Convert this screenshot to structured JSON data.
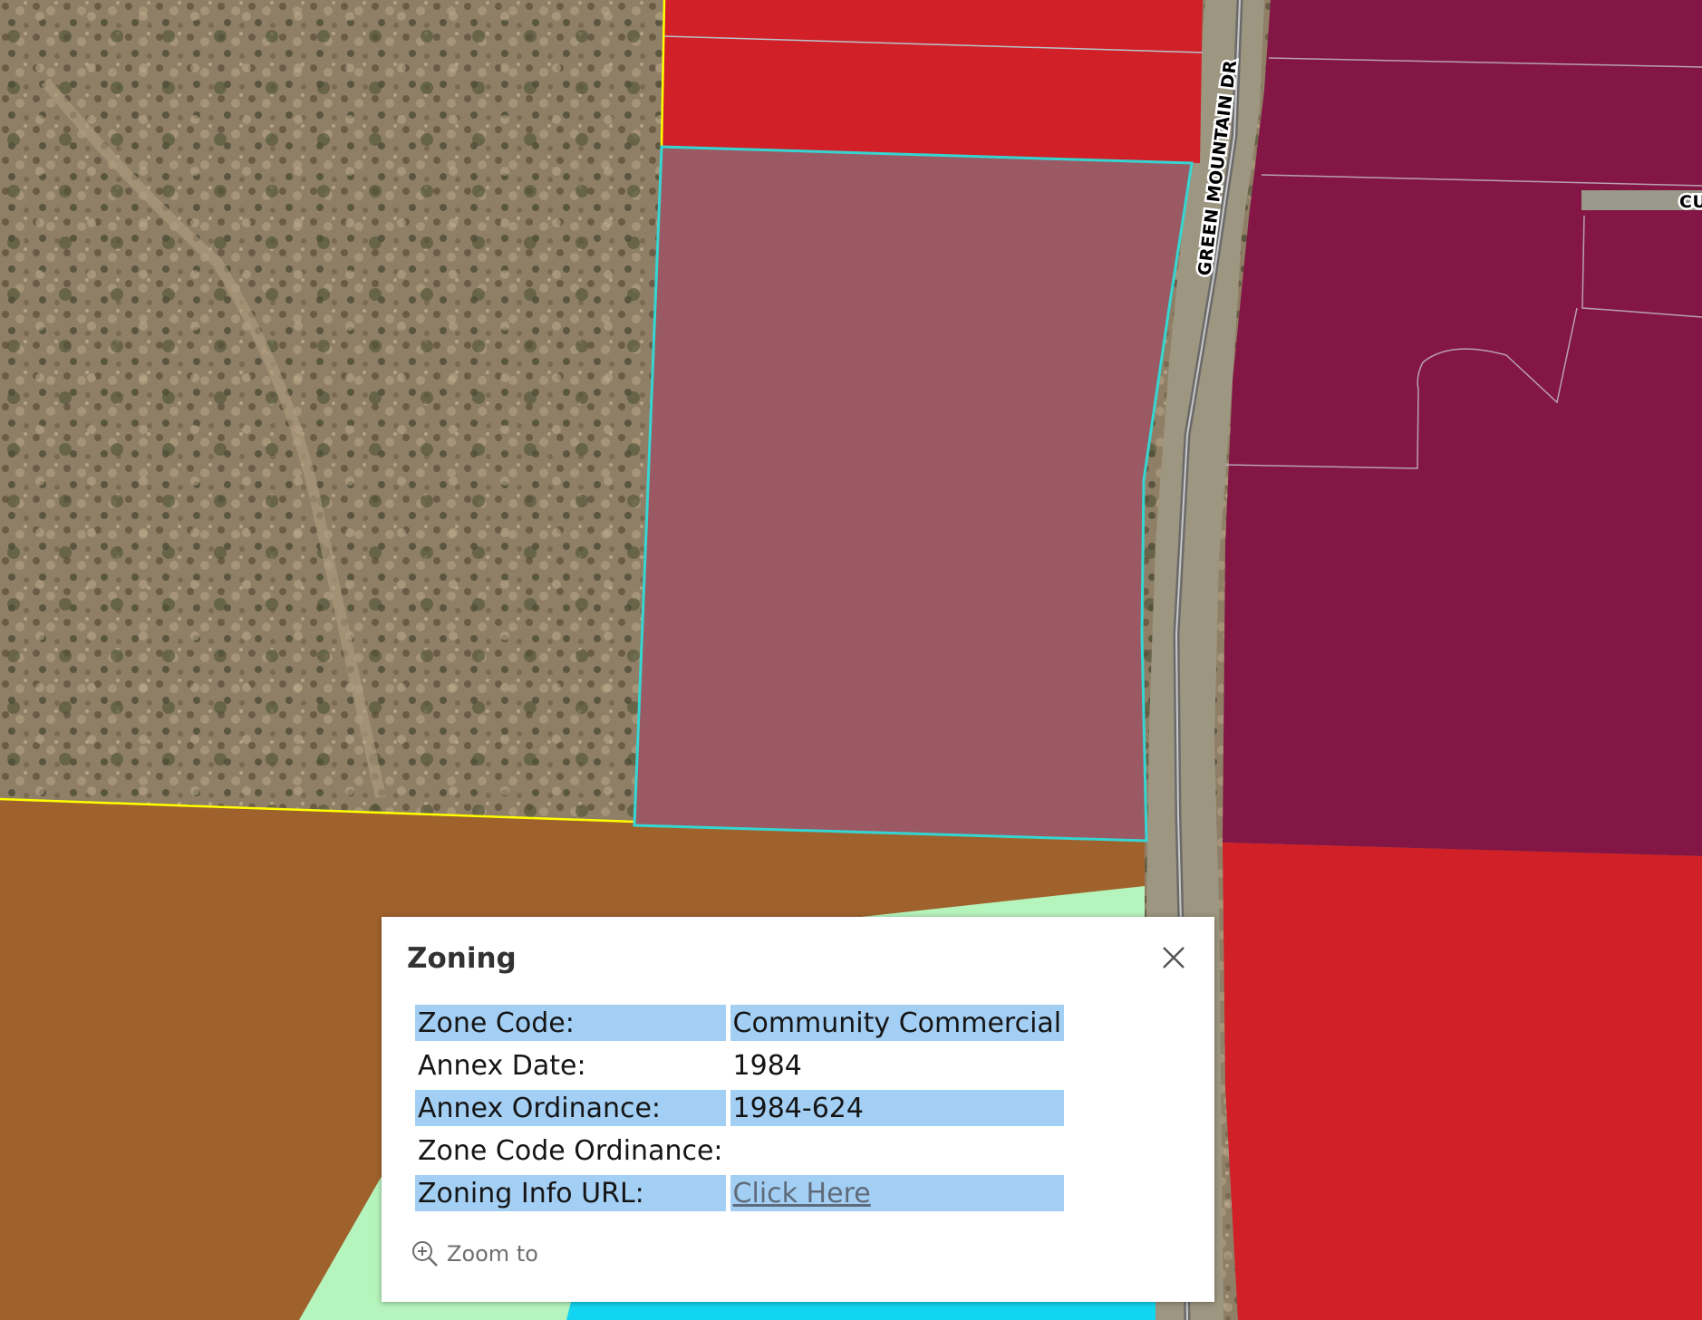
{
  "map": {
    "road_label": "GREEN MOUNTAIN DR",
    "side_road_label": "CU",
    "colors": {
      "commercial_red": "#d12027",
      "selected_parcel": "#9b5a63",
      "selection_outline": "#35d6d2",
      "maroon_zone": "#841645",
      "brown_zone": "#a0622c",
      "light_green_zone": "#b6f4bd",
      "cyan_zone": "#12d6f1",
      "boundary_yellow": "#ffff00"
    }
  },
  "popup": {
    "title": "Zoning",
    "rows": [
      {
        "label": "Zone Code:",
        "value": "Community Commercial",
        "highlight": true
      },
      {
        "label": "Annex Date:",
        "value": "1984",
        "highlight": false
      },
      {
        "label": "Annex Ordinance:",
        "value": "1984-624",
        "highlight": true
      },
      {
        "label": "Zone Code Ordinance:",
        "value": "",
        "highlight": false
      },
      {
        "label": "Zoning Info URL:",
        "value": "Click Here",
        "highlight": true,
        "link": true
      }
    ],
    "zoom_to_label": "Zoom to",
    "colors": {
      "row_highlight": "#a4cff4",
      "link": "#5f6b7a"
    }
  }
}
